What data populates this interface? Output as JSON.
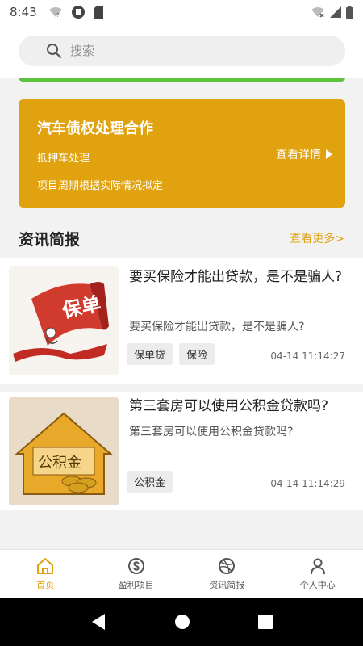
{
  "status": {
    "time": "8:43",
    "left_icons": [
      "wifi-question-icon",
      "app-notification-icon",
      "sd-card-icon"
    ],
    "right_icons": [
      "wifi-off-icon",
      "signal-icon",
      "battery-icon"
    ]
  },
  "search": {
    "placeholder": "搜索"
  },
  "banner": {
    "title": "汽车债权处理合作",
    "subtitle1": "抵押车处理",
    "subtitle2": "项目周期根据实际情况拟定",
    "link_label": "查看详情",
    "color": "#e0a20f"
  },
  "section": {
    "title": "资讯简报",
    "more_label": "查看更多>"
  },
  "news": [
    {
      "title": "要买保险才能出贷款，是不是骗人?",
      "summary": "要买保险才能出贷款，是不是骗人?",
      "tags": [
        "保单贷",
        "保险"
      ],
      "time": "04-14 11:14:27",
      "thumb_label": "保单"
    },
    {
      "title": "第三套房可以使用公积金贷款吗?",
      "summary": "第三套房可以使用公积金贷款吗?",
      "tags": [
        "公积金"
      ],
      "time": "04-14 11:14:29",
      "thumb_label": "公积金"
    }
  ],
  "nav": {
    "items": [
      {
        "label": "首页",
        "icon": "home-icon",
        "active": true
      },
      {
        "label": "盈利项目",
        "icon": "skype-icon",
        "active": false
      },
      {
        "label": "资讯简报",
        "icon": "dribbble-icon",
        "active": false
      },
      {
        "label": "个人中心",
        "icon": "user-icon",
        "active": false
      }
    ],
    "active_color": "#e0a20f"
  },
  "system_nav": [
    "back-icon",
    "home-circle-icon",
    "recents-icon"
  ]
}
